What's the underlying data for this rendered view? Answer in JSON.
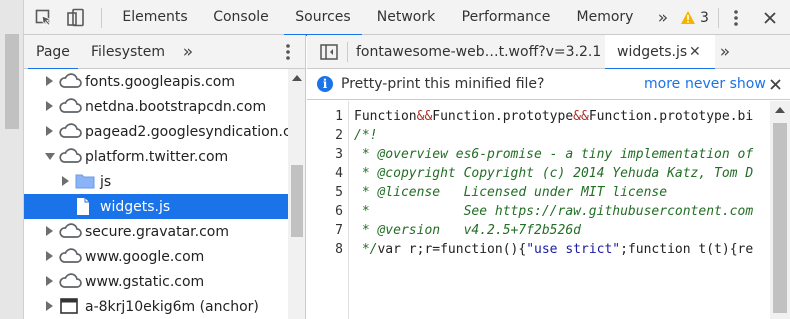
{
  "toolbar": {
    "tabs": [
      "Elements",
      "Console",
      "Sources",
      "Network",
      "Performance",
      "Memory"
    ],
    "active_tab": "Sources",
    "more_tabs_icon": "double-chevron-right-icon",
    "warning_count": "3",
    "warning_icon": "warning-triangle-icon",
    "menu_icon": "vertical-ellipsis-icon",
    "close_icon": "close-icon"
  },
  "navigator": {
    "tabs": [
      "Page",
      "Filesystem"
    ],
    "active_tab": "Page",
    "tree": [
      {
        "label": "fonts.googleapis.com",
        "icon": "cloud-icon",
        "expanded": false
      },
      {
        "label": "netdna.bootstrapcdn.com",
        "icon": "cloud-icon",
        "expanded": false
      },
      {
        "label": "pagead2.googlesyndication.co",
        "icon": "cloud-icon",
        "expanded": false
      },
      {
        "label": "platform.twitter.com",
        "icon": "cloud-icon",
        "expanded": true
      },
      {
        "label": "js",
        "icon": "folder-icon",
        "expanded": false
      },
      {
        "label": "widgets.js",
        "icon": "file-icon",
        "selected": true
      },
      {
        "label": "secure.gravatar.com",
        "icon": "cloud-icon",
        "expanded": false
      },
      {
        "label": "www.google.com",
        "icon": "cloud-icon",
        "expanded": false
      },
      {
        "label": "www.gstatic.com",
        "icon": "cloud-icon",
        "expanded": false
      },
      {
        "label": "a-8krj10ekig6m (anchor)",
        "icon": "frame-icon",
        "expanded": false
      }
    ]
  },
  "editor": {
    "tabs": [
      {
        "label": "fontawesome-web…t.woff?v=3.2.1",
        "active": false
      },
      {
        "label": "widgets.js",
        "active": true,
        "closable": true
      }
    ],
    "infobar": {
      "message": "Pretty-print this minified file?",
      "more_label": "more",
      "never_show_label": "never show"
    },
    "line_numbers": [
      "1",
      "2",
      "3",
      "4",
      "5",
      "6",
      "7",
      "8"
    ],
    "lines": [
      {
        "text": "Function&&Function.prototype&&Function.prototype.bi"
      },
      {
        "text": "/*!"
      },
      {
        "text": " * @overview es6-promise - a tiny implementation of"
      },
      {
        "text": " * @copyright Copyright (c) 2014 Yehuda Katz, Tom D"
      },
      {
        "text": " * @license   Licensed under MIT license"
      },
      {
        "text": " *            See https://raw.githubusercontent.com"
      },
      {
        "text": " * @version   v4.2.5+7f2b526d"
      },
      {
        "text": " */var r;r=function(){\"use strict\";function t(t){re"
      }
    ]
  },
  "colors": {
    "accent": "#1a73e8",
    "warning": "#f4b400",
    "comment": "#236e25",
    "operator": "#a9302a",
    "string": "#1a1aa6"
  }
}
